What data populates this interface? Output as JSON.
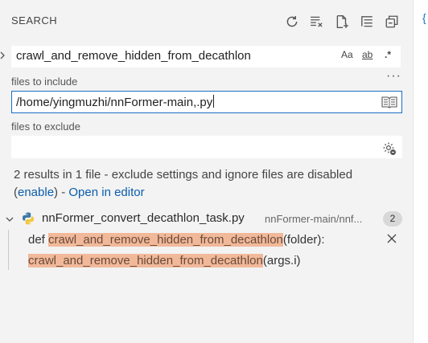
{
  "header": {
    "title": "SEARCH",
    "icons": [
      "refresh-icon",
      "clear-results-icon",
      "new-search-editor-icon",
      "tree-view-icon",
      "collapse-all-icon"
    ]
  },
  "search": {
    "query": "crawl_and_remove_hidden_from_decathlon",
    "options": {
      "match_case": "Aa",
      "whole_word": "ab",
      "regex": ".*"
    }
  },
  "include": {
    "label": "files to include",
    "value": "/home/yingmuzhi/nnFormer-main,.py"
  },
  "exclude": {
    "label": "files to exclude",
    "value": ""
  },
  "summary": {
    "text": "2 results in 1 file - exclude settings and ignore files are disabled",
    "paren_open": "(",
    "enable_link": "enable",
    "paren_close": ") - ",
    "open_editor_link": "Open in editor"
  },
  "results": {
    "file_name": "nnFormer_convert_decathlon_task.py",
    "file_path": "nnFormer-main/nnf...",
    "count": "2",
    "matches": [
      {
        "before": "def ",
        "match": "crawl_and_remove_hidden_from_decathlon",
        "after": "(folder):"
      },
      {
        "before": "",
        "match": "crawl_and_remove_hidden_from_decathlon",
        "after": "(args.i)"
      }
    ]
  },
  "colors": {
    "accent": "#1b6fc7",
    "link": "#0a5cad",
    "highlight": "#f1b99a",
    "background": "#f3f3f3"
  }
}
